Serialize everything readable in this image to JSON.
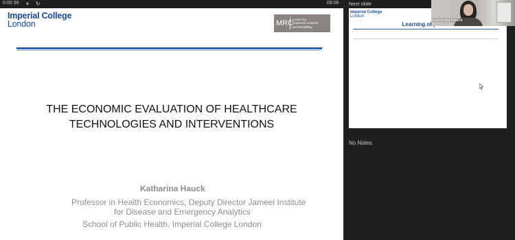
{
  "controls": {
    "elapsed": "0:00:39",
    "pause_icon": "⏸",
    "restart_icon": "↻",
    "clock": "09:06"
  },
  "current_slide": {
    "logo_line1": "Imperial College",
    "logo_line2": "London",
    "mrc_abbrev": "MRC",
    "mrc_lines": [
      "Centre for",
      "Outbreak Analysis",
      "and Modelling"
    ],
    "title_line1": "THE ECONOMIC EVALUATION OF HEALTHCARE",
    "title_line2": "TECHNOLOGIES AND INTERVENTIONS",
    "presenter": "Katharina Hauck",
    "affiliation_line1": "Professor in Health Economics, Deputy Director Jameel Institute",
    "affiliation_line2": "for Disease and Emergency Analytics",
    "affiliation_line3": "School of Public Health, Imperial College London"
  },
  "next_slide": {
    "label": "Next slide",
    "logo_line1": "Imperial College",
    "logo_line2": "London",
    "title": "Learning objectives"
  },
  "notes": {
    "text": "No Notes."
  },
  "webcam": {
    "name": "Katharina Hauck"
  },
  "colors": {
    "imperial_blue": "#16499a",
    "mrc_grey": "#8a8280",
    "background": "#1f1f1f"
  }
}
